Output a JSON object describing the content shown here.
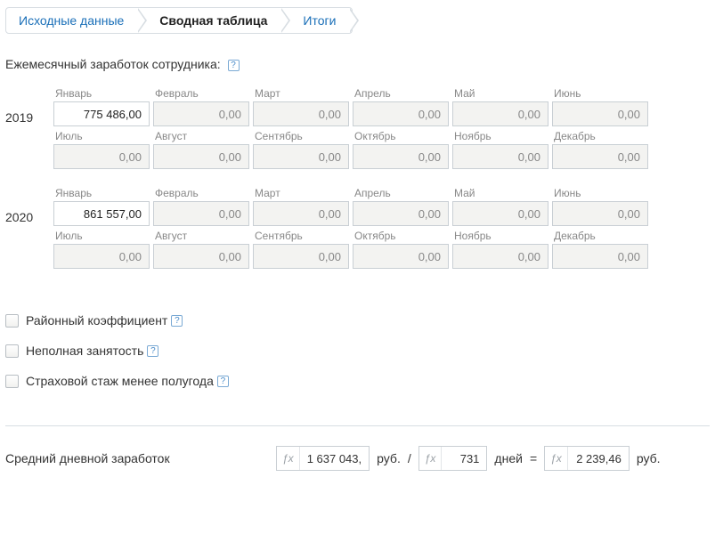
{
  "tabs": {
    "source": "Исходные данные",
    "pivot": "Сводная таблица",
    "totals": "Итоги"
  },
  "section_title": "Ежемесячный заработок сотрудника:",
  "months": [
    "Январь",
    "Февраль",
    "Март",
    "Апрель",
    "Май",
    "Июнь",
    "Июль",
    "Август",
    "Сентябрь",
    "Октябрь",
    "Ноябрь",
    "Декабрь"
  ],
  "years": [
    {
      "year": "2019",
      "values": [
        "775 486,00",
        "0,00",
        "0,00",
        "0,00",
        "0,00",
        "0,00",
        "0,00",
        "0,00",
        "0,00",
        "0,00",
        "0,00",
        "0,00"
      ]
    },
    {
      "year": "2020",
      "values": [
        "861 557,00",
        "0,00",
        "0,00",
        "0,00",
        "0,00",
        "0,00",
        "0,00",
        "0,00",
        "0,00",
        "0,00",
        "0,00",
        "0,00"
      ]
    }
  ],
  "options": {
    "regional": "Районный коэффициент",
    "parttime": "Неполная занятость",
    "insurance": "Страховой стаж менее полугода"
  },
  "summary": {
    "label": "Средний дневной заработок",
    "total": "1 637 043,",
    "unit_rub": "руб.",
    "slash": "/",
    "days_value": "731",
    "unit_days": "дней",
    "eq": "=",
    "result": "2 239,46",
    "unit_rub2": "руб."
  }
}
